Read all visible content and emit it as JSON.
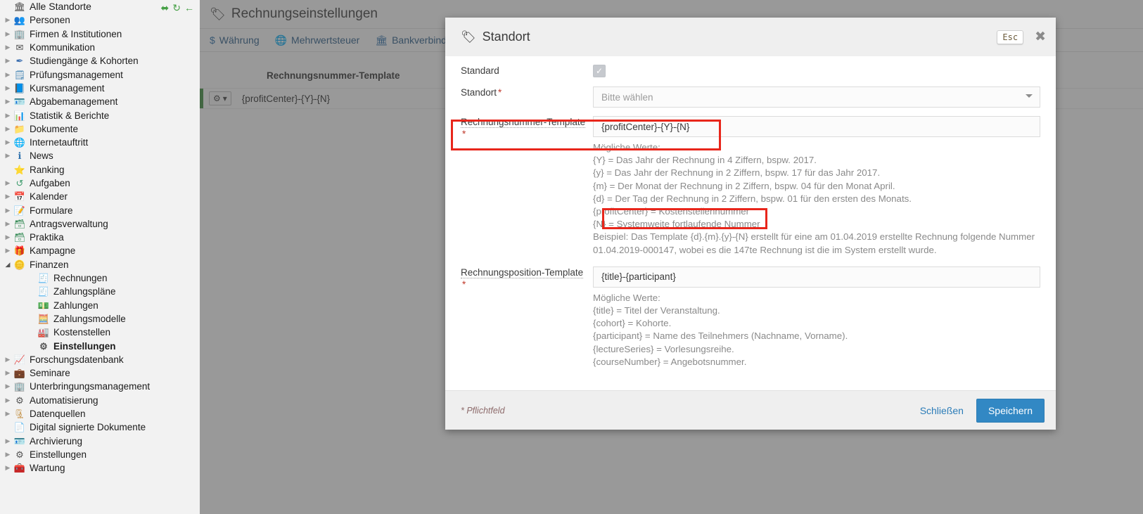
{
  "sidebar": {
    "tools": [
      {
        "name": "collapse-all-icon",
        "glyph": "⬌"
      },
      {
        "name": "refresh-icon",
        "glyph": "↻"
      },
      {
        "name": "back-arrow-icon",
        "glyph": "←"
      }
    ],
    "items": [
      {
        "label": "Alle Standorte",
        "icon": "🏛",
        "color": "#4a4a4a",
        "arrow": "",
        "indent": 0,
        "root": true
      },
      {
        "label": "Personen",
        "icon": "👥",
        "color": "#3f6fb5",
        "arrow": "▶",
        "indent": 0
      },
      {
        "label": "Firmen & Institutionen",
        "icon": "🏢",
        "color": "#2f6fb0",
        "arrow": "▶",
        "indent": 0
      },
      {
        "label": "Kommunikation",
        "icon": "✉",
        "color": "#4a4a4a",
        "arrow": "▶",
        "indent": 0
      },
      {
        "label": "Studiengänge & Kohorten",
        "icon": "✒",
        "color": "#3c6fb0",
        "arrow": "▶",
        "indent": 0
      },
      {
        "label": "Prüfungsmanagement",
        "icon": "🗒",
        "color": "#3c7fb1",
        "arrow": "▶",
        "indent": 0
      },
      {
        "label": "Kursmanagement",
        "icon": "📘",
        "color": "#2f6fb0",
        "arrow": "▶",
        "indent": 0
      },
      {
        "label": "Abgabemanagement",
        "icon": "🪪",
        "color": "#4b6e96",
        "arrow": "▶",
        "indent": 0
      },
      {
        "label": "Statistik & Berichte",
        "icon": "📊",
        "color": "#2f6fb0",
        "arrow": "▶",
        "indent": 0
      },
      {
        "label": "Dokumente",
        "icon": "📁",
        "color": "#4a80b8",
        "arrow": "▶",
        "indent": 0
      },
      {
        "label": "Internetauftritt",
        "icon": "🌐",
        "color": "#2f72ad",
        "arrow": "▶",
        "indent": 0
      },
      {
        "label": "News",
        "icon": "ℹ",
        "color": "#2f72ad",
        "arrow": "▶",
        "indent": 0
      },
      {
        "label": "Ranking",
        "icon": "⭐",
        "color": "#e2b53b",
        "arrow": "",
        "indent": 0
      },
      {
        "label": "Aufgaben",
        "icon": "↺",
        "color": "#3d9b6c",
        "arrow": "▶",
        "indent": 0
      },
      {
        "label": "Kalender",
        "icon": "📅",
        "color": "#6c7a8a",
        "arrow": "▶",
        "indent": 0
      },
      {
        "label": "Formulare",
        "icon": "📝",
        "color": "#7b5fa8",
        "arrow": "▶",
        "indent": 0
      },
      {
        "label": "Antragsverwaltung",
        "icon": "🗃",
        "color": "#3d8f5c",
        "arrow": "▶",
        "indent": 0
      },
      {
        "label": "Praktika",
        "icon": "🗃",
        "color": "#3d8f5c",
        "arrow": "▶",
        "indent": 0
      },
      {
        "label": "Kampagne",
        "icon": "🎁",
        "color": "#3f7fc0",
        "arrow": "▶",
        "indent": 0
      },
      {
        "label": "Finanzen",
        "icon": "🪙",
        "color": "#d6a32f",
        "arrow": "◢",
        "indent": 0,
        "expanded": true
      },
      {
        "label": "Rechnungen",
        "icon": "🧾",
        "color": "#3f8f5f",
        "arrow": "",
        "indent": 2
      },
      {
        "label": "Zahlungspläne",
        "icon": "🧾",
        "color": "#3f8f5f",
        "arrow": "",
        "indent": 2
      },
      {
        "label": "Zahlungen",
        "icon": "💵",
        "color": "#3d9b6c",
        "arrow": "",
        "indent": 2
      },
      {
        "label": "Zahlungsmodelle",
        "icon": "🧮",
        "color": "#2f6fb0",
        "arrow": "",
        "indent": 2
      },
      {
        "label": "Kostenstellen",
        "icon": "🏭",
        "color": "#2f6fb0",
        "arrow": "",
        "indent": 2
      },
      {
        "label": "Einstellungen",
        "icon": "⚙",
        "color": "#555",
        "arrow": "",
        "indent": 2,
        "bold": true
      },
      {
        "label": "Forschungsdatenbank",
        "icon": "📈",
        "color": "#2f72ad",
        "arrow": "▶",
        "indent": 0
      },
      {
        "label": "Seminare",
        "icon": "💼",
        "color": "#c08a3a",
        "arrow": "▶",
        "indent": 0
      },
      {
        "label": "Unterbringungsmanagement",
        "icon": "🏢",
        "color": "#4a6f9a",
        "arrow": "▶",
        "indent": 0
      },
      {
        "label": "Automatisierung",
        "icon": "⚙",
        "color": "#555",
        "arrow": "▶",
        "indent": 0
      },
      {
        "label": "Datenquellen",
        "icon": "🗜",
        "color": "#c08a3a",
        "arrow": "▶",
        "indent": 0
      },
      {
        "label": "Digital signierte Dokumente",
        "icon": "📄",
        "color": "#3d8f5c",
        "arrow": "",
        "indent": 0
      },
      {
        "label": "Archivierung",
        "icon": "🪪",
        "color": "#4b6e96",
        "arrow": "▶",
        "indent": 0
      },
      {
        "label": "Einstellungen",
        "icon": "⚙",
        "color": "#555",
        "arrow": "▶",
        "indent": 0
      },
      {
        "label": "Wartung",
        "icon": "🧰",
        "color": "#c0392b",
        "arrow": "▶",
        "indent": 0
      }
    ]
  },
  "main": {
    "title": "Rechnungseinstellungen",
    "toolbar": [
      {
        "label": "Währung",
        "icon": "$",
        "name": "currency"
      },
      {
        "label": "Mehrwertsteuer",
        "icon": "🌐",
        "name": "vat"
      },
      {
        "label": "Bankverbindung",
        "icon": "🏛",
        "name": "bank-account"
      }
    ],
    "column_header": "Rechnungsnummer-Template",
    "row_value": "{profitCenter}-{Y}-{N}",
    "row_menu_label": "⚙"
  },
  "dialog": {
    "title": "Standort",
    "esc_label": "Esc",
    "close_glyph": "✖",
    "fields": {
      "standard": {
        "label": "Standard",
        "checked": true,
        "check_glyph": "✓"
      },
      "standort": {
        "label": "Standort",
        "required": true,
        "placeholder": "Bitte wählen",
        "value": ""
      },
      "rechnungsnummer_template": {
        "label": "Rechnungsnummer-Template",
        "required": true,
        "value": "{profitCenter}-{Y}-{N}",
        "help_title": "Mögliche Werte:",
        "help_lines": [
          "{Y} = Das Jahr der Rechnung in 4 Ziffern, bspw. 2017.",
          "{y} = Das Jahr der Rechnung in 2 Ziffern, bspw. 17 für das Jahr 2017.",
          "{m} = Der Monat der Rechnung in 2 Ziffern, bspw. 04 für den Monat April.",
          "{d} = Der Tag der Rechnung in 2 Ziffern, bspw. 01 für den ersten des Monats.",
          "{profitCenter} = Kostenstellennummer",
          "{N} = Systemweite fortlaufende Nummer",
          "Beispiel: Das Template {d}.{m}.{y}-{N} erstellt für eine am 01.04.2019 erstellte Rechnung folgende Nummer 01.04.2019-000147, wobei es die 147te Rechnung ist die im System erstellt wurde."
        ]
      },
      "rechnungsposition_template": {
        "label": "Rechnungsposition-Template",
        "required": true,
        "value": "{title}-{participant}",
        "help_title": "Mögliche Werte:",
        "help_lines": [
          "{title} = Titel der Veranstaltung.",
          "{cohort} = Kohorte.",
          "{participant} = Name des Teilnehmers (Nachname, Vorname).",
          "{lectureSeries} = Vorlesungsreihe.",
          "{courseNumber} = Angebotsnummer."
        ]
      }
    },
    "footer": {
      "mandatory_note": "* Pflichtfeld",
      "close_label": "Schließen",
      "save_label": "Speichern"
    }
  },
  "annotations": {
    "highlight_color": "#e8261b",
    "boxes": [
      {
        "name": "highlight-rechnungsnummer-template-field"
      },
      {
        "name": "highlight-profitcenter-help-line"
      }
    ]
  }
}
